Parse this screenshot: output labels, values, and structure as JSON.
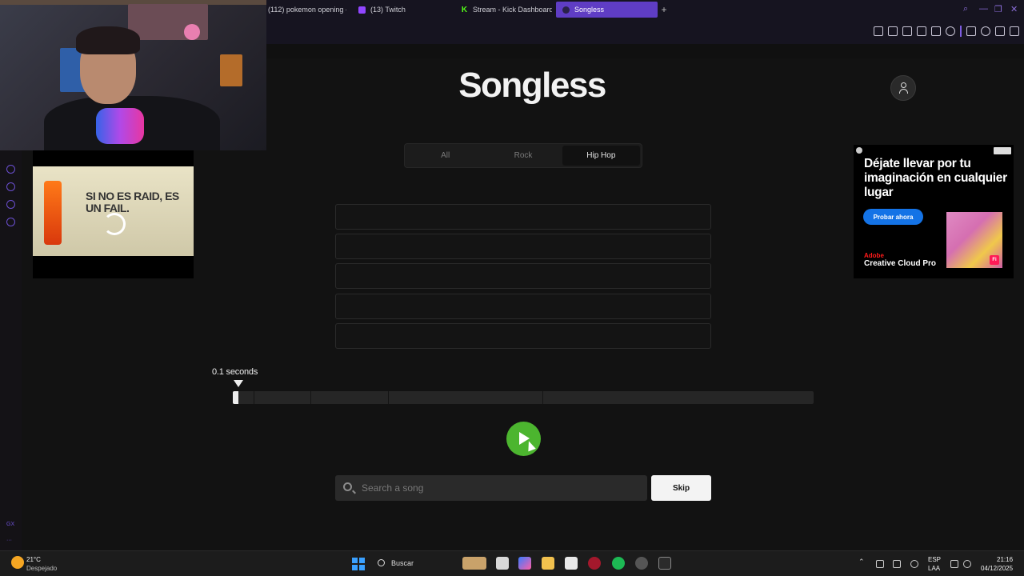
{
  "browser": {
    "tabs": [
      {
        "label": "(112) pokemon opening -",
        "active": false
      },
      {
        "label": "(13) Twitch",
        "active": false
      },
      {
        "label": "Stream - Kick Dashboard",
        "active": false
      },
      {
        "label": "Songless",
        "active": true
      }
    ],
    "new_tab_glyph": "+",
    "accent_color": "#5f3dc4"
  },
  "app": {
    "logo": "Songless",
    "genres": [
      {
        "label": "All",
        "active": false
      },
      {
        "label": "Rock",
        "active": false
      },
      {
        "label": "Hip Hop",
        "active": true
      }
    ],
    "guess_slots": 5,
    "timer_label": "0.1 seconds",
    "progress_fraction": 0.0095,
    "play_color": "#4cb52f",
    "search": {
      "placeholder": "Search a song",
      "value": ""
    },
    "skip_label": "Skip"
  },
  "ad_video": {
    "headline": "SI NO ES RAID, ES UN FAIL."
  },
  "display_ad": {
    "title": "Déjate llevar por tu imaginación en cualquier lugar",
    "cta": "Probar ahora",
    "brand": "Adobe",
    "product": "Creative Cloud Pro",
    "badge": "Fi"
  },
  "taskbar": {
    "weather_temp": "21°C",
    "weather_desc": "Despejado",
    "search_label": "Buscar",
    "language": "ESP",
    "language_sub": "LAA",
    "time": "21:16",
    "date": "04/12/2025"
  }
}
